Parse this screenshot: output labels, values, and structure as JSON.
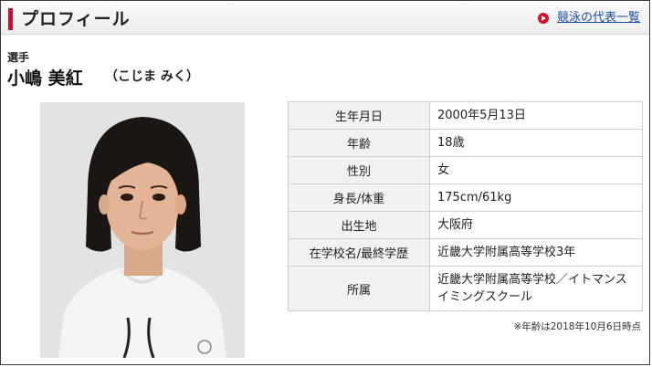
{
  "header": {
    "title": "プロフィール",
    "link_label": "競泳の代表一覧"
  },
  "athlete": {
    "role": "選手",
    "name": "小嶋 美紅",
    "kana": "（こじま みく）"
  },
  "profile_table": {
    "rows": [
      {
        "label": "生年月日",
        "value": "2000年5月13日"
      },
      {
        "label": "年齢",
        "value": "18歳"
      },
      {
        "label": "性別",
        "value": "女"
      },
      {
        "label": "身長/体重",
        "value": "175cm/61kg"
      },
      {
        "label": "出生地",
        "value": "大阪府"
      },
      {
        "label": "在学校名/最終学歴",
        "value": "近畿大学附属高等学校3年"
      },
      {
        "label": "所属",
        "value": "近畿大学附属高等学校／イトマンスイミングスクール"
      }
    ]
  },
  "footnote": "※年齢は2018年10月6日時点",
  "colors": {
    "accent_red": "#c8102e",
    "link_blue": "#1a4fa0",
    "label_cell_bg": "#f1f1f1"
  }
}
